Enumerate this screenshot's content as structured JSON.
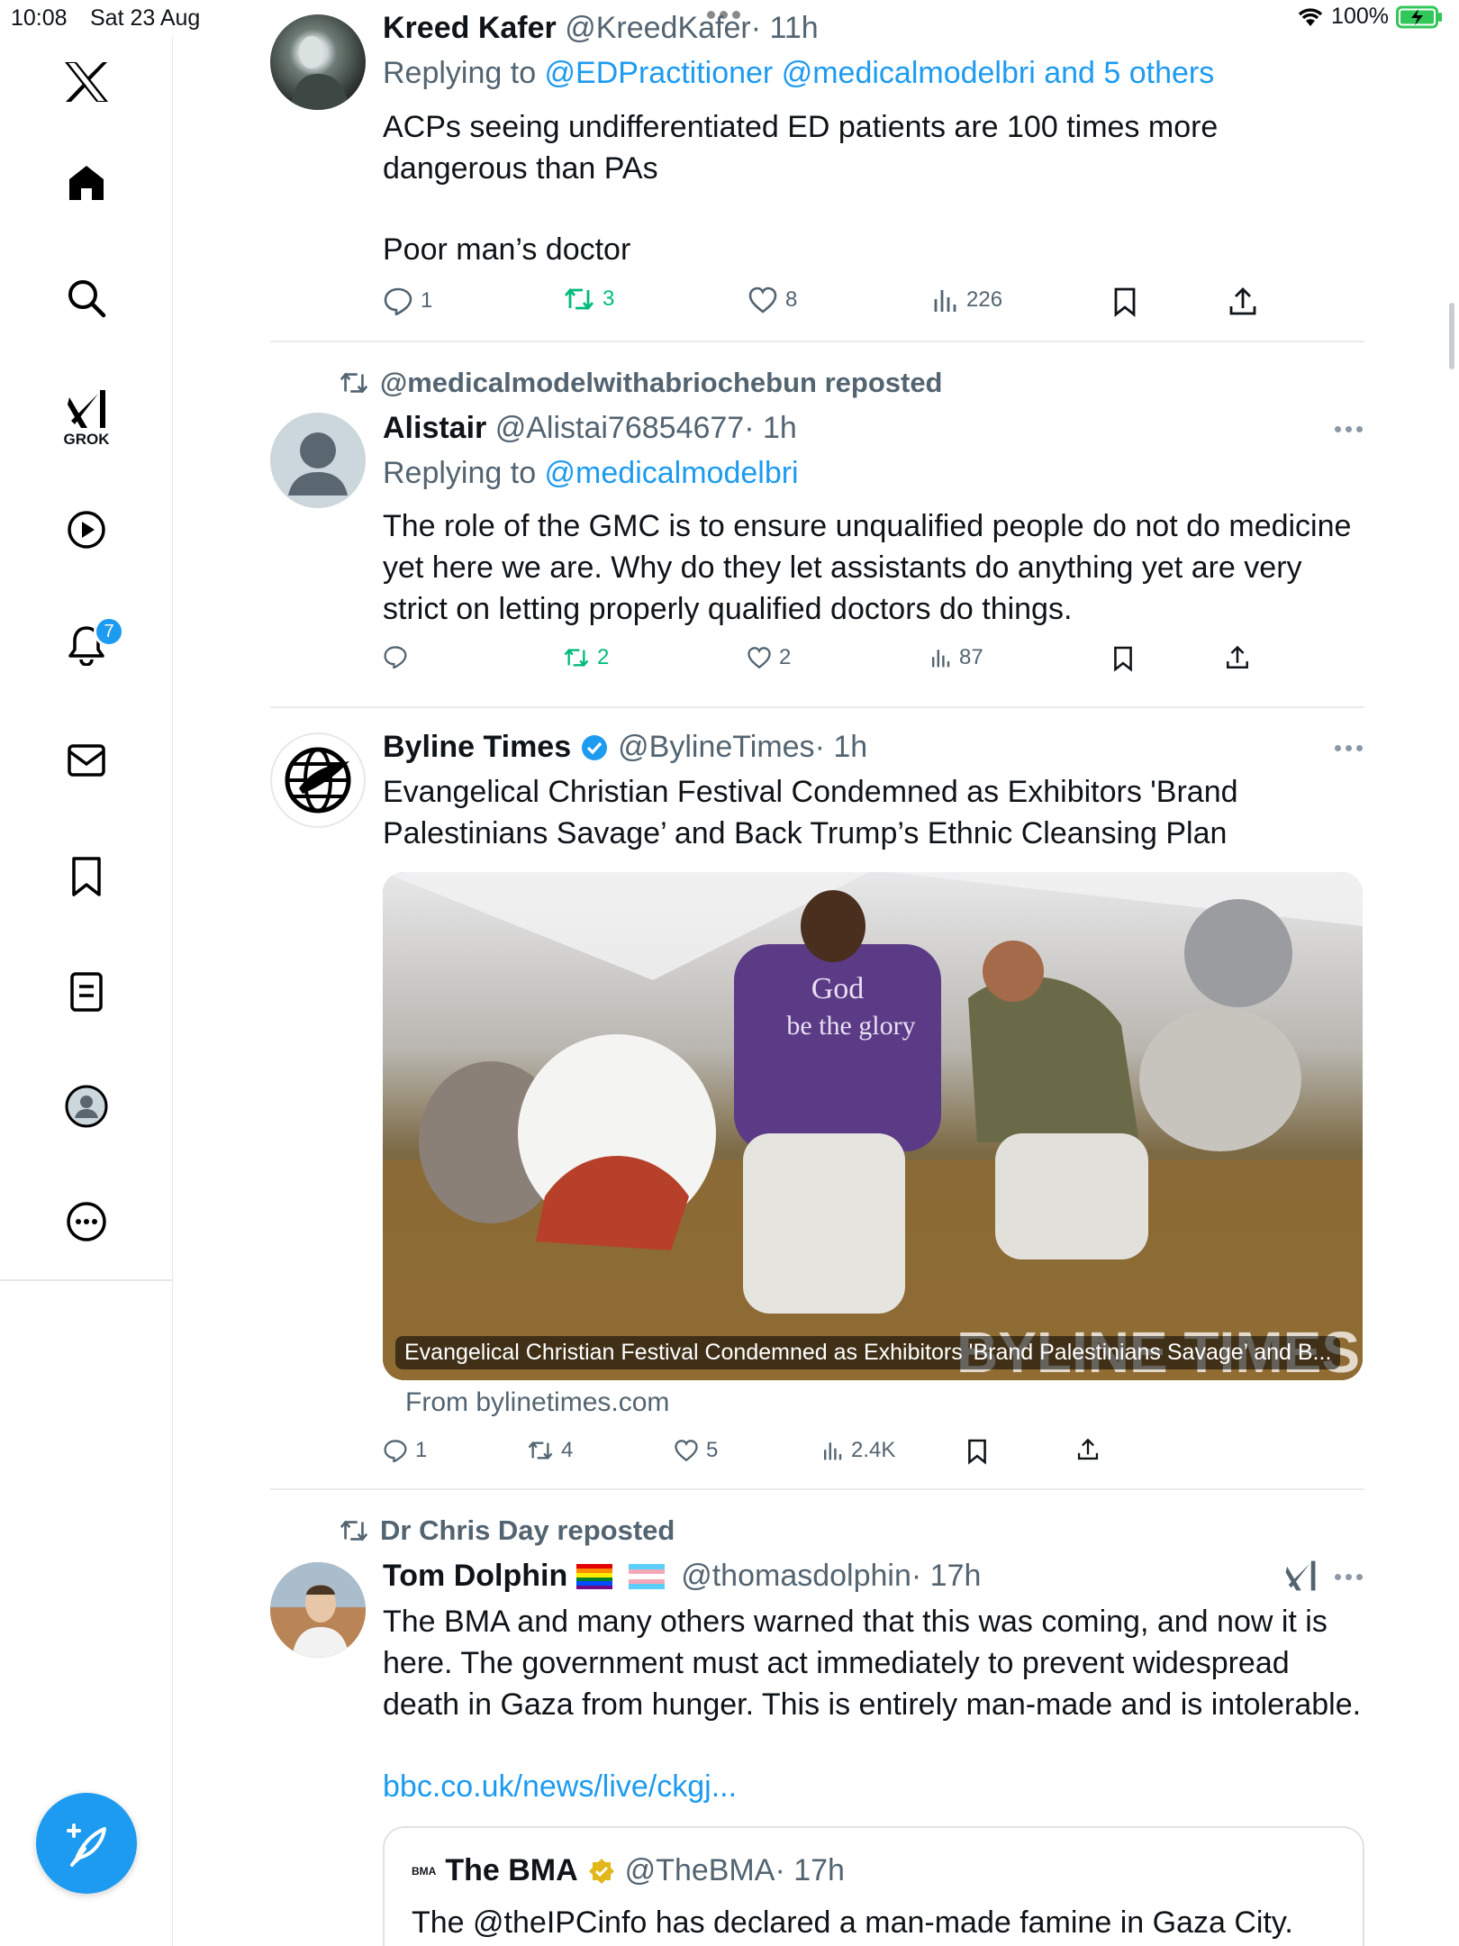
{
  "status": {
    "time": "10:08",
    "date": "Sat 23 Aug",
    "battery": "100%"
  },
  "sidebar": {
    "notifications_badge": "7",
    "grok_label": "GROK"
  },
  "tweets": [
    {
      "name": "Kreed Kafer",
      "handle": "@KreedKafer",
      "time": "· 11h",
      "replying_prefix": "Replying to ",
      "replying_to": "@EDPractitioner @medicalmodelbri and 5 others",
      "body_line1": "ACPs seeing undifferentiated ED patients are 100 times more",
      "body_line2": "dangerous than PAs",
      "body_line3": "Poor man’s doctor",
      "replies": "1",
      "reposts": "3",
      "likes": "8",
      "views": "226"
    },
    {
      "reposted_by": "@medicalmodelwithabriochebun reposted",
      "name": "Alistair",
      "handle": "@Alistai76854677",
      "time": "· 1h",
      "replying_prefix": "Replying to ",
      "replying_to": "@medicalmodelbri",
      "body_line1": "The role of the GMC is to ensure unqualified people do not do medicine",
      "body_line2": "yet here we are. Why do they let assistants do anything yet are very",
      "body_line3": "strict on letting properly qualified doctors do things.",
      "replies": "",
      "reposts": "2",
      "likes": "2",
      "views": "87"
    },
    {
      "name": "Byline Times",
      "handle": "@BylineTimes",
      "time": "· 1h",
      "body_line1": "Evangelical Christian Festival Condemned as Exhibitors 'Brand",
      "body_line2": "Palestinians Savage’ and Back Trump’s Ethnic Cleansing Plan",
      "card_caption": "Evangelical Christian Festival Condemned as Exhibitors 'Brand Palestinians Savage’ and B...",
      "card_watermark": "BYLINE TIMES",
      "shirt_text1": "God",
      "shirt_text2": "be the glory",
      "from": "From bylinetimes.com",
      "replies": "1",
      "reposts": "4",
      "likes": "5",
      "views": "2.4K"
    },
    {
      "reposted_by": "Dr Chris Day reposted",
      "name": "Tom Dolphin",
      "handle": "@thomasdolphin",
      "time": "· 17h",
      "body_line1": "The BMA and many others warned that this was coming, and now it is",
      "body_line2": "here. The government must act immediately to prevent widespread",
      "body_line3": "death in Gaza from hunger. This is entirely man-made and is intolerable.",
      "link": "bbc.co.uk/news/live/ckgj...",
      "quote_logo": "BMA",
      "quote_name": "The BMA",
      "quote_handle": "@TheBMA",
      "quote_time": "· 17h",
      "quote_body": "The @theIPCinfo has declared a man-made famine in Gaza City."
    }
  ]
}
